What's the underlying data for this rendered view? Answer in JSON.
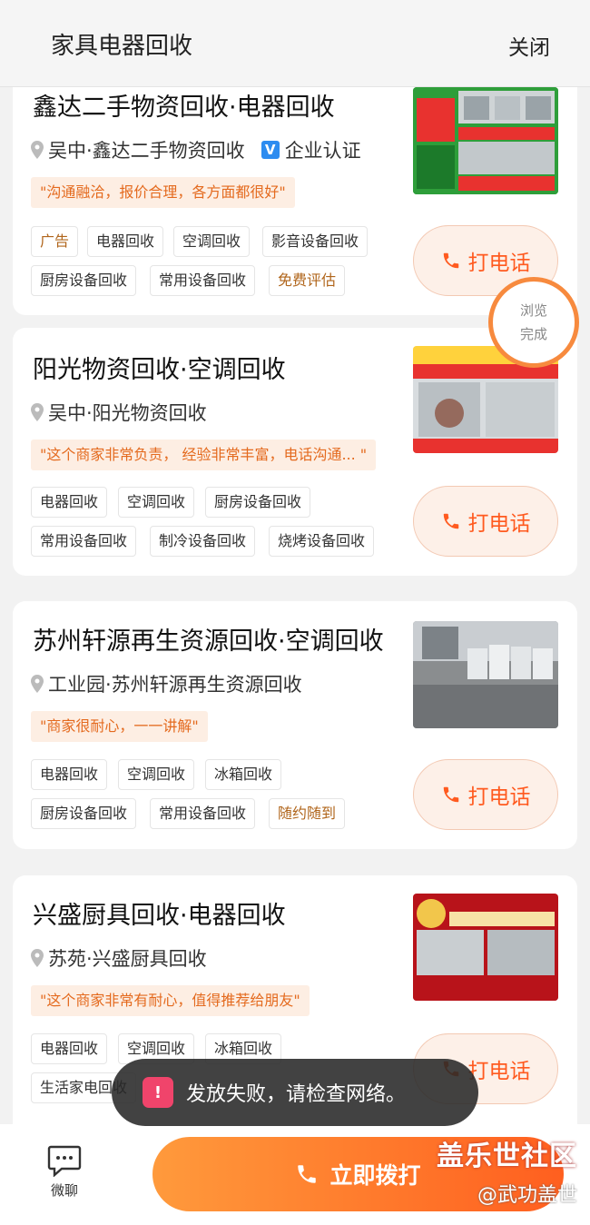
{
  "header": {
    "title": "家具电器回收",
    "close_label": "关闭"
  },
  "browse_done": {
    "line1": "浏览",
    "line2": "完成"
  },
  "cards": [
    {
      "name": "鑫达二手物资回收·电器回收",
      "location": "吴中·鑫达二手物资回收",
      "verify_label": "企业认证",
      "review": "\"沟通融洽，报价合理，各方面都很好\"",
      "tags": [
        "广告",
        "电器回收",
        "空调回收",
        "影音设备回收",
        "厨房设备回收",
        "常用设备回收",
        "免费评估"
      ],
      "thumb_text": [
        "鑫达",
        "回收",
        "空调制冷",
        "烘焙设备",
        "厨房设备",
        "酒店饭店",
        "商用设备",
        "冰柜冷柜",
        "中央空调",
        "整体回收饭店酒店厨房设备",
        "打包回收"
      ],
      "call_label": "打电话"
    },
    {
      "name": "阳光物资回收·空调回收",
      "location": "吴中·阳光物资回收",
      "review": "\"这个商家非常负责， 经验非常丰富，电话沟通... \"",
      "tags": [
        "电器回收",
        "空调回收",
        "厨房设备回收",
        "常用设备回收",
        "制冷设备回收",
        "烧烤设备回收"
      ],
      "thumb_text": [
        "阳光物资",
        "家电 空调 中央空调 上下床",
        "收",
        "酒店宾馆设备 库房积压 清退库存"
      ],
      "call_label": "打电话"
    },
    {
      "name": "苏州轩源再生资源回收·空调回收",
      "location": "工业园·苏州轩源再生资源回收",
      "review": "\"商家很耐心，一一讲解\"",
      "tags": [
        "电器回收",
        "空调回收",
        "冰箱回收",
        "厨房设备回收",
        "常用设备回收",
        "随约随到"
      ],
      "call_label": "打电话"
    },
    {
      "name": "兴盛厨具回收·电器回收",
      "location": "苏苑·兴盛厨具回收",
      "review": "\"这个商家非常有耐心，值得推荐给朋友\"",
      "tags": [
        "电器回收",
        "空调回收",
        "冰箱回收",
        "生活家电回收"
      ],
      "thumb_text": [
        "收",
        "兴盛厨具回收",
        "高价上门回收",
        "酒店设备 厨房设备 火锅店",
        "空调电器 餐馆宾馆 奶茶店"
      ],
      "call_label": "打电话"
    }
  ],
  "toast": {
    "text": "发放失败，请检查网络。"
  },
  "footer": {
    "chat_label": "微聊",
    "dial_label": "立即拨打"
  },
  "watermark": {
    "line1": "盖乐世社区",
    "line2": "@武功盖世"
  },
  "colors": {
    "accent": "#ff5a1f",
    "review_bg": "#fdeee3",
    "toast_bg": "#282828"
  }
}
